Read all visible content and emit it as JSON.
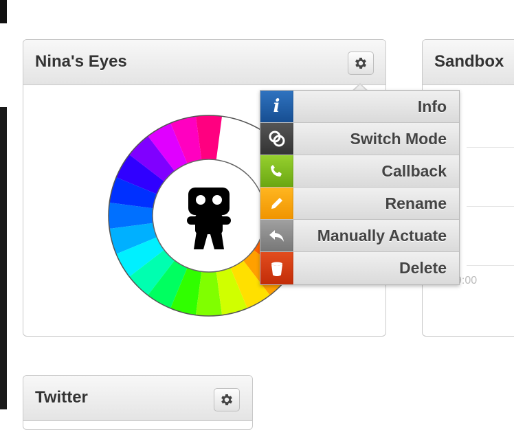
{
  "widgets": {
    "nina": {
      "title": "Nina's Eyes",
      "gear_icon": "gear-icon"
    },
    "sandbox": {
      "title": "Sandbox",
      "time_text": "9:00"
    },
    "twitter": {
      "title": "Twitter",
      "gear_icon": "gear-icon"
    }
  },
  "color_wheel": {
    "center_icon": "ninja-icon",
    "segment_colors": [
      "#ff0080",
      "#ff00c0",
      "#e000ff",
      "#8000ff",
      "#3000ff",
      "#0030ff",
      "#0070ff",
      "#00b0ff",
      "#00f0ff",
      "#00ffb0",
      "#00ff60",
      "#30ff00",
      "#80ff00",
      "#d0ff00",
      "#ffe000",
      "#ffa000",
      "#ff6000",
      "#ff0000",
      "#ff0040"
    ]
  },
  "menu": {
    "items": [
      {
        "label": "Info",
        "icon": "info-icon",
        "color": "#1d5aa3"
      },
      {
        "label": "Switch Mode",
        "icon": "link-rings-icon",
        "color": "#444444"
      },
      {
        "label": "Callback",
        "icon": "phone-icon",
        "color": "#7db81c"
      },
      {
        "label": "Rename",
        "icon": "pencil-icon",
        "color": "#f5a000"
      },
      {
        "label": "Manually Actuate",
        "icon": "reply-arrow-icon",
        "color": "#8a8a8a"
      },
      {
        "label": "Delete",
        "icon": "trash-icon",
        "color": "#d33a10"
      }
    ]
  }
}
